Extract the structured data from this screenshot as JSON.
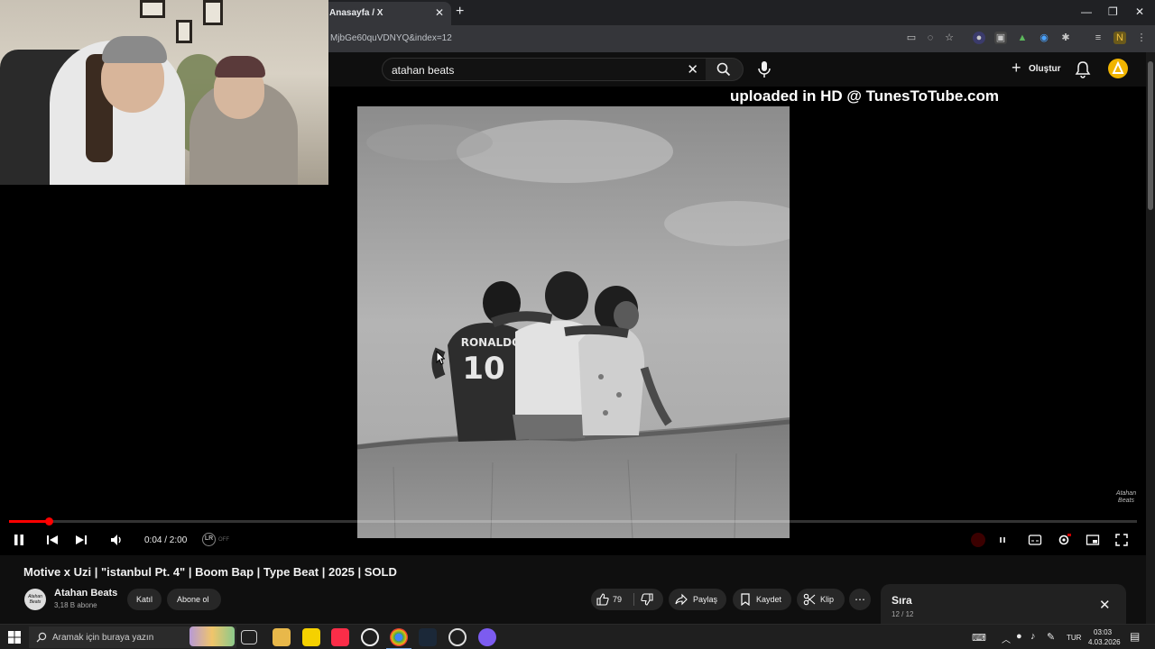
{
  "browser": {
    "tab_title": "Anasayfa / X",
    "tab_close": "✕",
    "new_tab": "+",
    "url": "MjbGe60quVDNYQ&index=12",
    "window_controls": [
      "—",
      "❐",
      "✕"
    ]
  },
  "youtube_header": {
    "search_value": "atahan beats",
    "clear_glyph": "✕",
    "create_label": "Oluştur",
    "create_glyph": "+",
    "avatar_color": "#f0b400"
  },
  "player": {
    "watermark": "uploaded in HD @ TunesToTube.com",
    "time": "0:04 / 2:00",
    "progress_fraction": 0.035,
    "lr_label": "LR",
    "lr_state": "OFF",
    "jersey_name": "RONALDO",
    "jersey_number": "10",
    "brand_mark": "Atahan Beats",
    "accent_color": "#ff0000"
  },
  "video": {
    "title": "Motive x Uzi | \"istanbul Pt. 4\" | Boom Bap | Type Beat | 2025 | SOLD",
    "channel_name": "Atahan Beats",
    "channel_avatar_text": "Atahan Beats",
    "subscribers": "3,18 B abone",
    "join_label": "Katıl",
    "subscribe_label": "Abone ol",
    "likes": "79",
    "share_label": "Paylaş",
    "save_label": "Kaydet",
    "clip_label": "Klip",
    "more_glyph": "⋯"
  },
  "queue": {
    "title": "Sıra",
    "count": "12 / 12",
    "close_glyph": "✕"
  },
  "taskbar": {
    "search_placeholder": "Aramak için buraya yazın",
    "language": "TUR",
    "time": "03:03",
    "date": "4.03.2026"
  }
}
